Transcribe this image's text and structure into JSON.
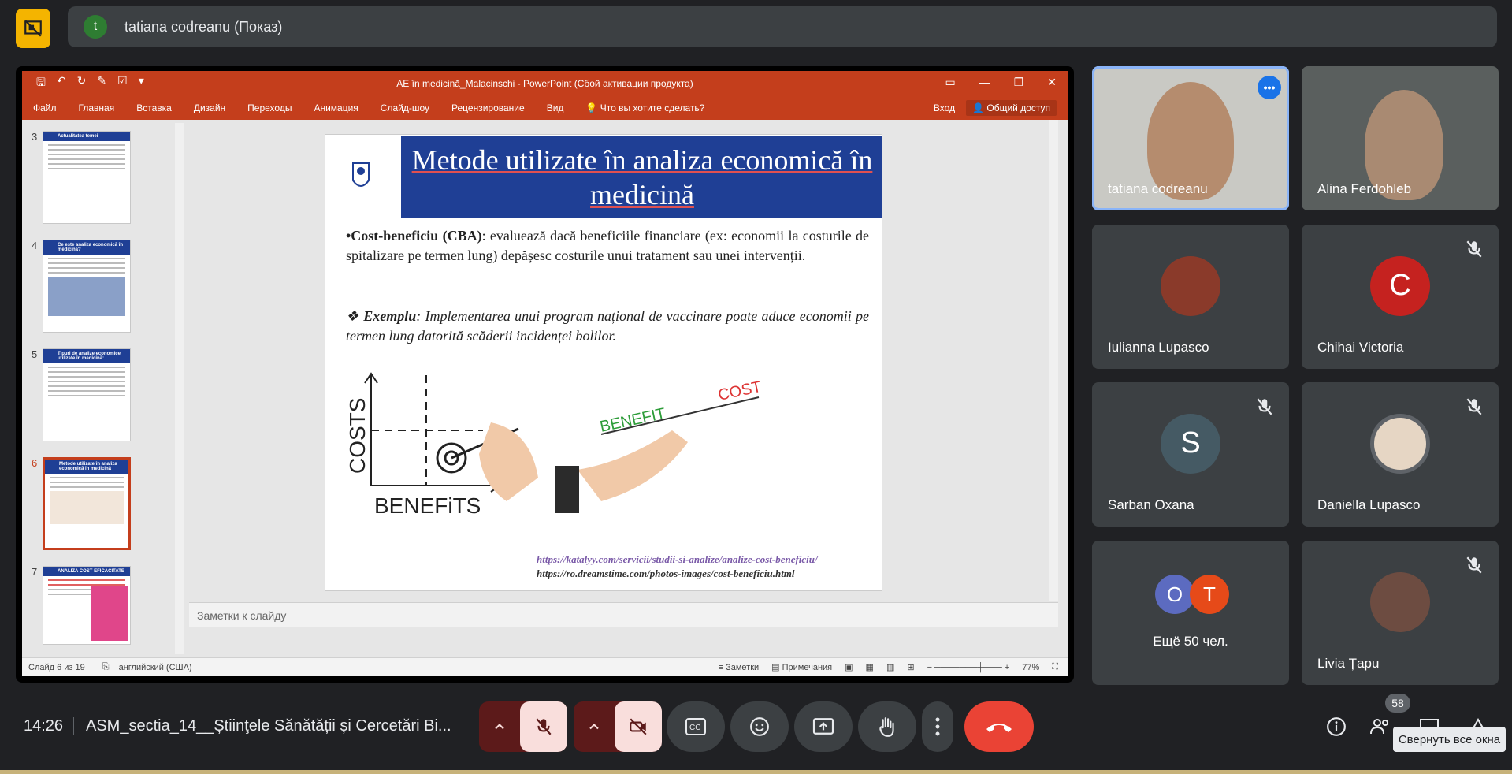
{
  "presenter_bar": {
    "name": "tatiana codreanu (Показ)",
    "avatar_letter": "t"
  },
  "powerpoint": {
    "window_title": "AE în medicină_Malacinschi - PowerPoint (Сбой активации продукта)",
    "ribbon_tabs": [
      "Файл",
      "Главная",
      "Вставка",
      "Дизайн",
      "Переходы",
      "Анимация",
      "Слайд-шоу",
      "Рецензирование",
      "Вид"
    ],
    "tell_me": "Что вы хотите сделать?",
    "sign_in": "Вход",
    "share": "Общий доступ",
    "thumbnails": [
      {
        "num": "3",
        "title": "Actualitatea temei"
      },
      {
        "num": "4",
        "title": "Ce este analiza economică în medicină?"
      },
      {
        "num": "5",
        "title": "Tipuri de analize economice utilizate în medicină:"
      },
      {
        "num": "6",
        "title": "Metode utilizate în analiza economică în medicină"
      },
      {
        "num": "7",
        "title": "ANALIZA COST EFICACITATE"
      }
    ],
    "slide": {
      "title": "Metode utilizate în analiza economică în medicină",
      "bullet_prefix": "•Cost-beneficiu (CBA)",
      "bullet_rest": ": evaluează dacă beneficiile financiare (ex: economii la costurile de spitalizare pe termen lung) depășesc costurile unui tratament sau unei intervenții.",
      "example_label": "Exemplu",
      "example_text": ": Implementarea unui program național de vaccinare poate aduce economii pe termen lung datorită scăderii incidenței bolilor.",
      "graph_y": "COSTS",
      "graph_x": "BENEFiTS",
      "scale_benefit": "BENEFIT",
      "scale_cost": "COST",
      "url1": "https://katalyy.com/servicii/studii-si-analize/analize-cost-beneficiu/",
      "url2": "https://ro.dreamstime.com/photos-images/cost-beneficiu.html"
    },
    "notes_placeholder": "Заметки к слайду",
    "status": {
      "slide_counter": "Слайд 6 из 19",
      "language": "английский (США)",
      "notes": "Заметки",
      "comments": "Примечания",
      "zoom": "77%"
    }
  },
  "participants": [
    {
      "name": "tatiana codreanu",
      "type": "video",
      "speaking": true
    },
    {
      "name": "Alina Ferdohleb",
      "type": "video",
      "speaking": false
    },
    {
      "name": "Iulianna Lupasco",
      "type": "avatar-image",
      "muted": false
    },
    {
      "name": "Chihai Victoria",
      "type": "letter",
      "letter": "C",
      "color": "#c5221f",
      "muted": true
    },
    {
      "name": "Sarban Oxana",
      "type": "letter",
      "letter": "S",
      "color": "#455a64",
      "muted": true
    },
    {
      "name": "Daniella Lupasco",
      "type": "avatar-image",
      "muted": true
    },
    {
      "name": "Ещё 50 чел.",
      "type": "more",
      "letters": [
        "O",
        "T"
      ],
      "colors": [
        "#5c6bc0",
        "#e64a19"
      ]
    },
    {
      "name": "Livia Țapu",
      "type": "avatar-image",
      "muted": true
    }
  ],
  "bottom_bar": {
    "time": "14:26",
    "meeting_name": "ASM_sectia_14__Știinţele Sănătății și Cercetări Bi...",
    "participant_count": "58",
    "tooltip": "Свернуть все окна"
  },
  "colors": {
    "accent": "#1a73e8",
    "ppt_orange": "#c43e1c",
    "slide_blue": "#1f3f95",
    "end_call": "#ea4335"
  }
}
